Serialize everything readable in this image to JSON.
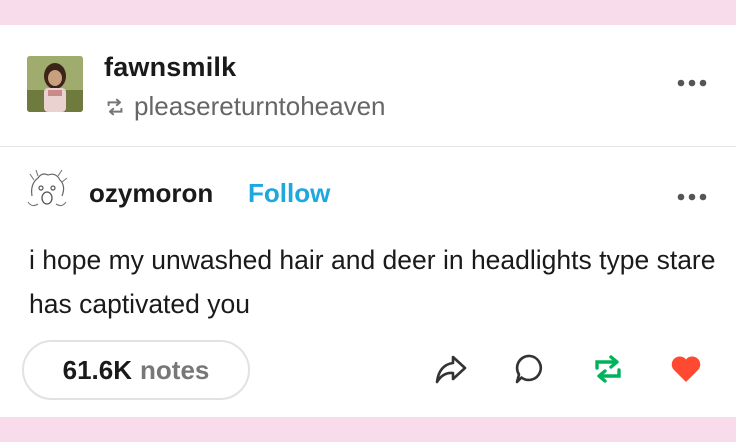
{
  "reblog_header": {
    "username": "fawnsmilk",
    "reblogged_from": "pleasereturntoheaven"
  },
  "original_post": {
    "username": "ozymoron",
    "follow_label": "Follow",
    "text": "i hope my unwashed hair and deer in headlights type stare has captivated you"
  },
  "footer": {
    "notes_count": "61.6K",
    "notes_label": "notes"
  },
  "icons": {
    "reblog_small": "reblog-icon",
    "more": "more-dots-icon",
    "share": "share-icon",
    "reply": "reply-icon",
    "reblog": "reblog-icon",
    "like": "heart-icon"
  },
  "colors": {
    "background": "#f9dcec",
    "follow": "#1ea8e0",
    "reblog_action": "#00b35a",
    "like_action": "#ff4930"
  }
}
